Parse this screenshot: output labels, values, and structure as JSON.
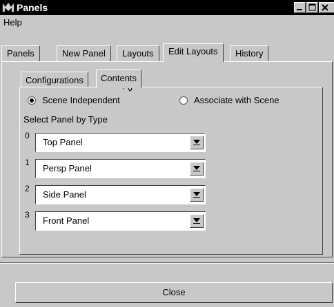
{
  "window": {
    "title": "Panels",
    "app_icon": "maya-icon"
  },
  "menu": {
    "items": [
      "Help"
    ]
  },
  "tabs": [
    {
      "label": "Panels",
      "active": false
    },
    {
      "label": "New Panel",
      "active": false
    },
    {
      "label": "Layouts",
      "active": false
    },
    {
      "label": "Edit Layouts",
      "active": true
    },
    {
      "label": "History",
      "active": false
    }
  ],
  "subtabs": [
    {
      "label": "Configurations",
      "active": false
    },
    {
      "label": "Contents",
      "active": true
    }
  ],
  "radios": [
    {
      "label": "Scene Independent",
      "selected": true
    },
    {
      "label": "Associate with Scene",
      "selected": false
    }
  ],
  "select_label": "Select Panel by Type",
  "panels": [
    {
      "index": "0",
      "value": "Top Panel"
    },
    {
      "index": "1",
      "value": "Persp Panel"
    },
    {
      "index": "2",
      "value": "Side Panel"
    },
    {
      "index": "3",
      "value": "Front Panel"
    }
  ],
  "close_label": "Close"
}
